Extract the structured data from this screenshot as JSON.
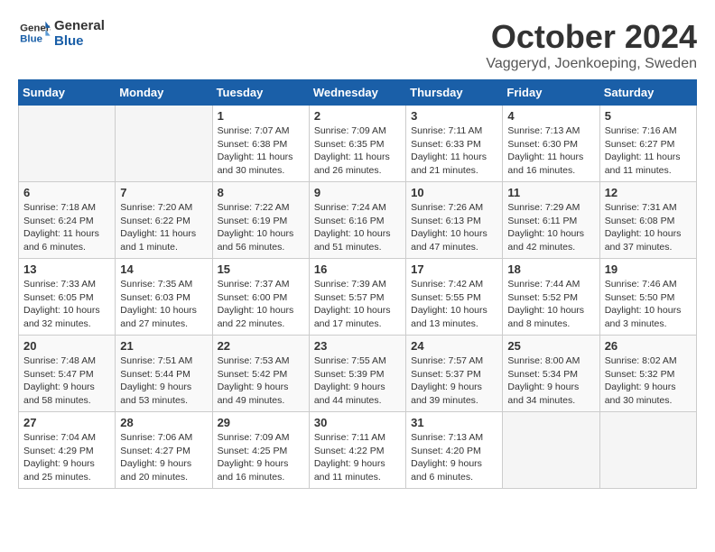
{
  "logo": {
    "line1": "General",
    "line2": "Blue"
  },
  "title": "October 2024",
  "location": "Vaggeryd, Joenkoeping, Sweden",
  "days_of_week": [
    "Sunday",
    "Monday",
    "Tuesday",
    "Wednesday",
    "Thursday",
    "Friday",
    "Saturday"
  ],
  "weeks": [
    [
      {
        "day": "",
        "info": ""
      },
      {
        "day": "",
        "info": ""
      },
      {
        "day": "1",
        "info": "Sunrise: 7:07 AM\nSunset: 6:38 PM\nDaylight: 11 hours\nand 30 minutes."
      },
      {
        "day": "2",
        "info": "Sunrise: 7:09 AM\nSunset: 6:35 PM\nDaylight: 11 hours\nand 26 minutes."
      },
      {
        "day": "3",
        "info": "Sunrise: 7:11 AM\nSunset: 6:33 PM\nDaylight: 11 hours\nand 21 minutes."
      },
      {
        "day": "4",
        "info": "Sunrise: 7:13 AM\nSunset: 6:30 PM\nDaylight: 11 hours\nand 16 minutes."
      },
      {
        "day": "5",
        "info": "Sunrise: 7:16 AM\nSunset: 6:27 PM\nDaylight: 11 hours\nand 11 minutes."
      }
    ],
    [
      {
        "day": "6",
        "info": "Sunrise: 7:18 AM\nSunset: 6:24 PM\nDaylight: 11 hours\nand 6 minutes."
      },
      {
        "day": "7",
        "info": "Sunrise: 7:20 AM\nSunset: 6:22 PM\nDaylight: 11 hours\nand 1 minute."
      },
      {
        "day": "8",
        "info": "Sunrise: 7:22 AM\nSunset: 6:19 PM\nDaylight: 10 hours\nand 56 minutes."
      },
      {
        "day": "9",
        "info": "Sunrise: 7:24 AM\nSunset: 6:16 PM\nDaylight: 10 hours\nand 51 minutes."
      },
      {
        "day": "10",
        "info": "Sunrise: 7:26 AM\nSunset: 6:13 PM\nDaylight: 10 hours\nand 47 minutes."
      },
      {
        "day": "11",
        "info": "Sunrise: 7:29 AM\nSunset: 6:11 PM\nDaylight: 10 hours\nand 42 minutes."
      },
      {
        "day": "12",
        "info": "Sunrise: 7:31 AM\nSunset: 6:08 PM\nDaylight: 10 hours\nand 37 minutes."
      }
    ],
    [
      {
        "day": "13",
        "info": "Sunrise: 7:33 AM\nSunset: 6:05 PM\nDaylight: 10 hours\nand 32 minutes."
      },
      {
        "day": "14",
        "info": "Sunrise: 7:35 AM\nSunset: 6:03 PM\nDaylight: 10 hours\nand 27 minutes."
      },
      {
        "day": "15",
        "info": "Sunrise: 7:37 AM\nSunset: 6:00 PM\nDaylight: 10 hours\nand 22 minutes."
      },
      {
        "day": "16",
        "info": "Sunrise: 7:39 AM\nSunset: 5:57 PM\nDaylight: 10 hours\nand 17 minutes."
      },
      {
        "day": "17",
        "info": "Sunrise: 7:42 AM\nSunset: 5:55 PM\nDaylight: 10 hours\nand 13 minutes."
      },
      {
        "day": "18",
        "info": "Sunrise: 7:44 AM\nSunset: 5:52 PM\nDaylight: 10 hours\nand 8 minutes."
      },
      {
        "day": "19",
        "info": "Sunrise: 7:46 AM\nSunset: 5:50 PM\nDaylight: 10 hours\nand 3 minutes."
      }
    ],
    [
      {
        "day": "20",
        "info": "Sunrise: 7:48 AM\nSunset: 5:47 PM\nDaylight: 9 hours\nand 58 minutes."
      },
      {
        "day": "21",
        "info": "Sunrise: 7:51 AM\nSunset: 5:44 PM\nDaylight: 9 hours\nand 53 minutes."
      },
      {
        "day": "22",
        "info": "Sunrise: 7:53 AM\nSunset: 5:42 PM\nDaylight: 9 hours\nand 49 minutes."
      },
      {
        "day": "23",
        "info": "Sunrise: 7:55 AM\nSunset: 5:39 PM\nDaylight: 9 hours\nand 44 minutes."
      },
      {
        "day": "24",
        "info": "Sunrise: 7:57 AM\nSunset: 5:37 PM\nDaylight: 9 hours\nand 39 minutes."
      },
      {
        "day": "25",
        "info": "Sunrise: 8:00 AM\nSunset: 5:34 PM\nDaylight: 9 hours\nand 34 minutes."
      },
      {
        "day": "26",
        "info": "Sunrise: 8:02 AM\nSunset: 5:32 PM\nDaylight: 9 hours\nand 30 minutes."
      }
    ],
    [
      {
        "day": "27",
        "info": "Sunrise: 7:04 AM\nSunset: 4:29 PM\nDaylight: 9 hours\nand 25 minutes."
      },
      {
        "day": "28",
        "info": "Sunrise: 7:06 AM\nSunset: 4:27 PM\nDaylight: 9 hours\nand 20 minutes."
      },
      {
        "day": "29",
        "info": "Sunrise: 7:09 AM\nSunset: 4:25 PM\nDaylight: 9 hours\nand 16 minutes."
      },
      {
        "day": "30",
        "info": "Sunrise: 7:11 AM\nSunset: 4:22 PM\nDaylight: 9 hours\nand 11 minutes."
      },
      {
        "day": "31",
        "info": "Sunrise: 7:13 AM\nSunset: 4:20 PM\nDaylight: 9 hours\nand 6 minutes."
      },
      {
        "day": "",
        "info": ""
      },
      {
        "day": "",
        "info": ""
      }
    ]
  ]
}
